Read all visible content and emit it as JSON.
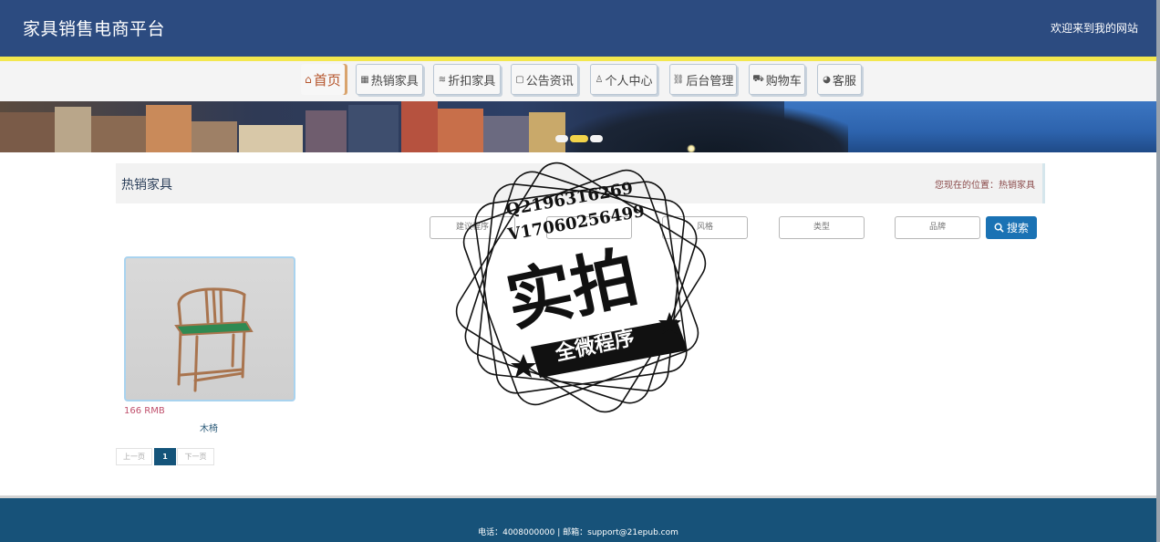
{
  "header": {
    "title": "家具销售电商平台",
    "welcome": "欢迎来到我的网站"
  },
  "nav": {
    "items": [
      {
        "label": "首页",
        "icon": "home-icon",
        "active": true
      },
      {
        "label": "热销家具",
        "icon": "grid-icon",
        "active": false
      },
      {
        "label": "折扣家具",
        "icon": "layers-icon",
        "active": false
      },
      {
        "label": "公告资讯",
        "icon": "note-icon",
        "active": false
      },
      {
        "label": "个人中心",
        "icon": "user-icon",
        "active": false
      },
      {
        "label": "后台管理",
        "icon": "link-icon",
        "active": false
      },
      {
        "label": "购物车",
        "icon": "cart-icon",
        "active": false
      },
      {
        "label": "客服",
        "icon": "chat-icon",
        "active": false
      }
    ]
  },
  "banner": {
    "slides": 3,
    "active_slide": 2
  },
  "section": {
    "title": "热销家具",
    "location": "您现在的位置：热销家具"
  },
  "search": {
    "fields": [
      {
        "placeholder": "建议程序"
      },
      {
        "placeholder": ""
      },
      {
        "placeholder": "风格"
      },
      {
        "placeholder": "类型"
      },
      {
        "placeholder": "品牌"
      }
    ],
    "button": "搜索"
  },
  "products": [
    {
      "price": "166 RMB",
      "name": "木椅"
    }
  ],
  "pagination": {
    "prev": "上一页",
    "current": "1",
    "next": "下一页"
  },
  "footer": {
    "contact": "电话：4008000000 | 邮箱：support@21epub.com"
  },
  "watermark": {
    "line1": "Q2196316269",
    "line2": "V17060256499",
    "main": "实拍",
    "ribbon": "全微程序"
  },
  "colors": {
    "header_bg": "#2c4b80",
    "accent_yellow": "#f3e74e",
    "search_button": "#1a72b4",
    "footer_bg": "#175279",
    "price": "#c0506c"
  }
}
